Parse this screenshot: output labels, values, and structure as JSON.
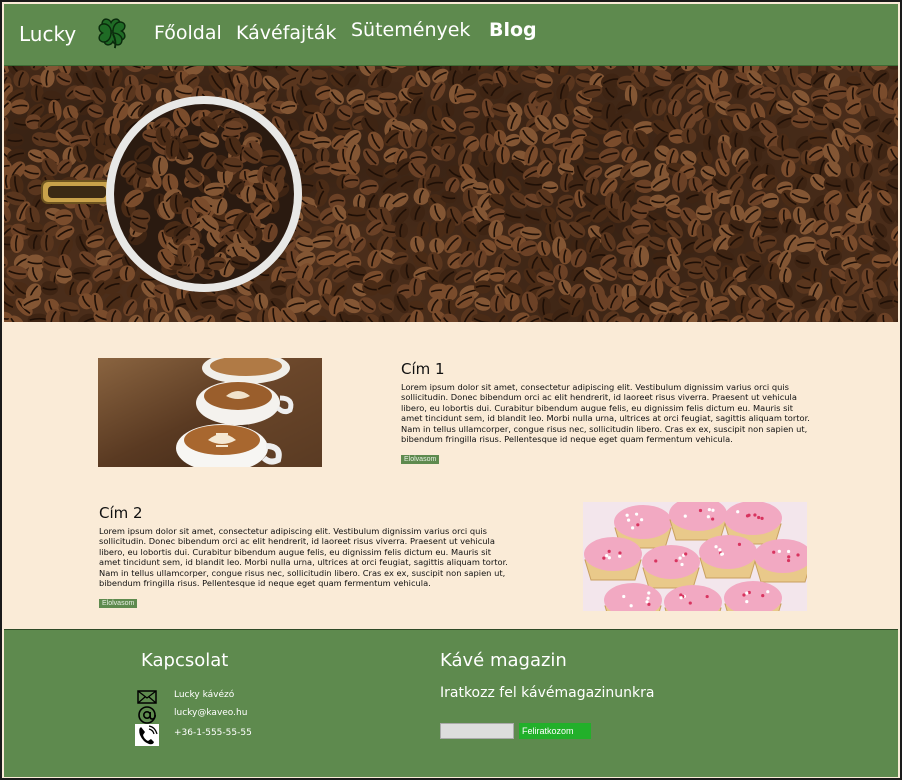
{
  "nav": {
    "brand": "Lucky",
    "logo_icon": "four-leaf-clover-icon",
    "links": [
      {
        "label": "Főoldal",
        "active": false
      },
      {
        "label": "Kávéfajták",
        "active": false
      },
      {
        "label": "Sütemények",
        "active": false
      },
      {
        "label": "Blog",
        "active": true
      }
    ]
  },
  "hero": {
    "image": "coffee-beans-with-cup"
  },
  "articles": [
    {
      "title": "Cím 1",
      "body": "Lorem ipsum dolor sit amet, consectetur adipiscing elit. Vestibulum dignissim varius orci quis sollicitudin. Donec bibendum orci ac elit hendrerit, id laoreet risus viverra. Praesent ut vehicula libero, eu lobortis dui. Curabitur bibendum augue felis, eu dignissim felis dictum eu. Mauris sit amet tincidunt sem, id blandit leo. Morbi nulla urna, ultrices at orci feugiat, sagittis aliquam tortor. Nam in tellus ullamcorper, congue risus nec, sollicitudin libero. Cras ex ex, suscipit non sapien ut, bibendum fringilla risus. Pellentesque id neque eget quam fermentum vehicula.",
      "button": "Elolvasom",
      "image": "latte-art-cups"
    },
    {
      "title": "Cím 2",
      "body": "Lorem ipsum dolor sit amet, consectetur adipiscing elit. Vestibulum dignissim varius orci quis sollicitudin. Donec bibendum orci ac elit hendrerit, id laoreet risus viverra. Praesent ut vehicula libero, eu lobortis dui. Curabitur bibendum augue felis, eu dignissim felis dictum eu. Mauris sit amet tincidunt sem, id blandit leo. Morbi nulla urna, ultrices at orci feugiat, sagittis aliquam tortor. Nam in tellus ullamcorper, congue risus nec, sollicitudin libero. Cras ex ex, suscipit non sapien ut, bibendum fringilla risus. Pellentesque id neque eget quam fermentum vehicula.",
      "button": "Elolvasom",
      "image": "pink-frosted-cupcakes"
    }
  ],
  "footer": {
    "contact": {
      "title": "Kapcsolat",
      "items": [
        {
          "icon": "envelope-icon",
          "text": "Lucky kávézó"
        },
        {
          "icon": "at-sign-icon",
          "text": "lucky@kaveo.hu"
        },
        {
          "icon": "phone-icon",
          "text": "+36-1-555-55-55"
        }
      ]
    },
    "magazine": {
      "title": "Kávé magazin",
      "subtitle": "Iratkozz fel kávémagazinunkra",
      "email_value": "",
      "button": "Feliratkozom"
    }
  },
  "colors": {
    "nav_bg": "#5e8a4e",
    "content_bg": "#faebd7",
    "subscribe_button": "#22b02a"
  }
}
